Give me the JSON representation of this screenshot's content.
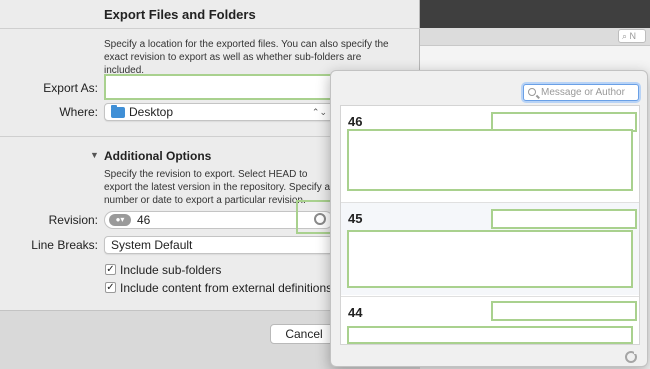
{
  "sheet": {
    "title": "Export Files and Folders",
    "description": "Specify a location for the exported files. You can also specify the exact revision to export as well as whether sub-folders are included.",
    "export_as_label": "Export As:",
    "export_as_value": "",
    "where_label": "Where:",
    "where_value": "Desktop",
    "section_title": "Additional Options",
    "section_description": "Specify the revision to export. Select HEAD to export the latest version in the repository. Specify a number or date to export a particular revision.",
    "revision_label": "Revision:",
    "revision_value": "46",
    "line_breaks_label": "Line Breaks:",
    "line_breaks_value": "System Default",
    "checkboxes": [
      {
        "label": "Include sub-folders",
        "checked": true
      },
      {
        "label": "Include content from external definitions",
        "checked": true
      }
    ],
    "cancel_label": "Cancel"
  },
  "background_window": {
    "search_placeholder": "N"
  },
  "popover": {
    "search_placeholder": "Message or Author",
    "revisions": [
      {
        "number": "46"
      },
      {
        "number": "45"
      },
      {
        "number": "44"
      }
    ]
  },
  "colors": {
    "highlight_frame": "#a9d18e",
    "focus_blue": "#6aa0e6",
    "folder_blue": "#3f8fd6"
  }
}
